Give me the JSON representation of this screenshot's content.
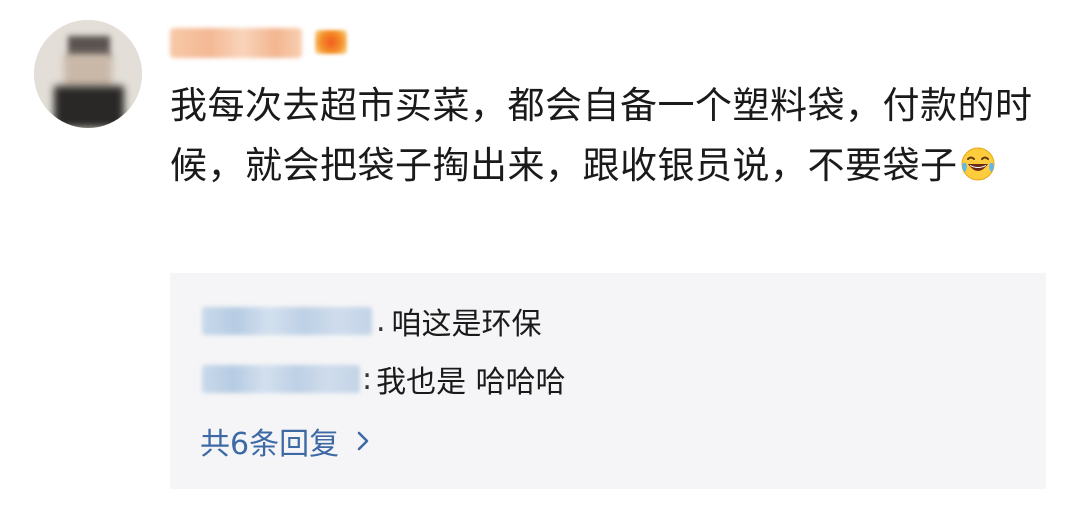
{
  "comment": {
    "author_avatar_icon": "avatar",
    "author_badge_icon": "vip-badge-icon",
    "text": "我每次去超市买菜，都会自备一个塑料袋，付款的时候，就会把袋子掏出来，跟收银员说，不要袋子",
    "emoji_icon": "laugh-cry-emoji-icon"
  },
  "replies": {
    "items": [
      {
        "separator": ".",
        "text": "咱这是环保"
      },
      {
        "separator": ":",
        "text": "我也是 哈哈哈"
      }
    ],
    "more_label": "共6条回复",
    "more_icon": "chevron-right-icon"
  },
  "colors": {
    "text": "#1a1a1a",
    "link": "#3d6aa5",
    "reply_bg": "#f5f5f7"
  }
}
